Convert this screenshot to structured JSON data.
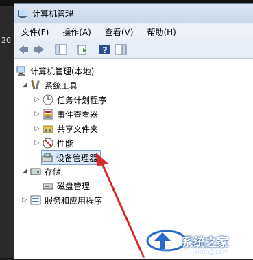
{
  "desktop": {
    "clock_fragment": "20"
  },
  "window": {
    "title": "计算机管理",
    "menu": [
      "文件(F)",
      "操作(A)",
      "查看(V)",
      "帮助(H)"
    ]
  },
  "tree": {
    "root": "计算机管理(本地)",
    "system_tools": "系统工具",
    "task_scheduler": "任务计划程序",
    "event_viewer": "事件查看器",
    "shared_folders": "共享文件夹",
    "performance": "性能",
    "device_manager": "设备管理器",
    "storage": "存储",
    "disk_management": "磁盘管理",
    "services_apps": "服务和应用程序"
  },
  "watermark": {
    "text": "系统之家",
    "url": "xitong.com"
  },
  "colors": {
    "arrow": "#d42a2a",
    "selection": "#d9e8fb"
  }
}
